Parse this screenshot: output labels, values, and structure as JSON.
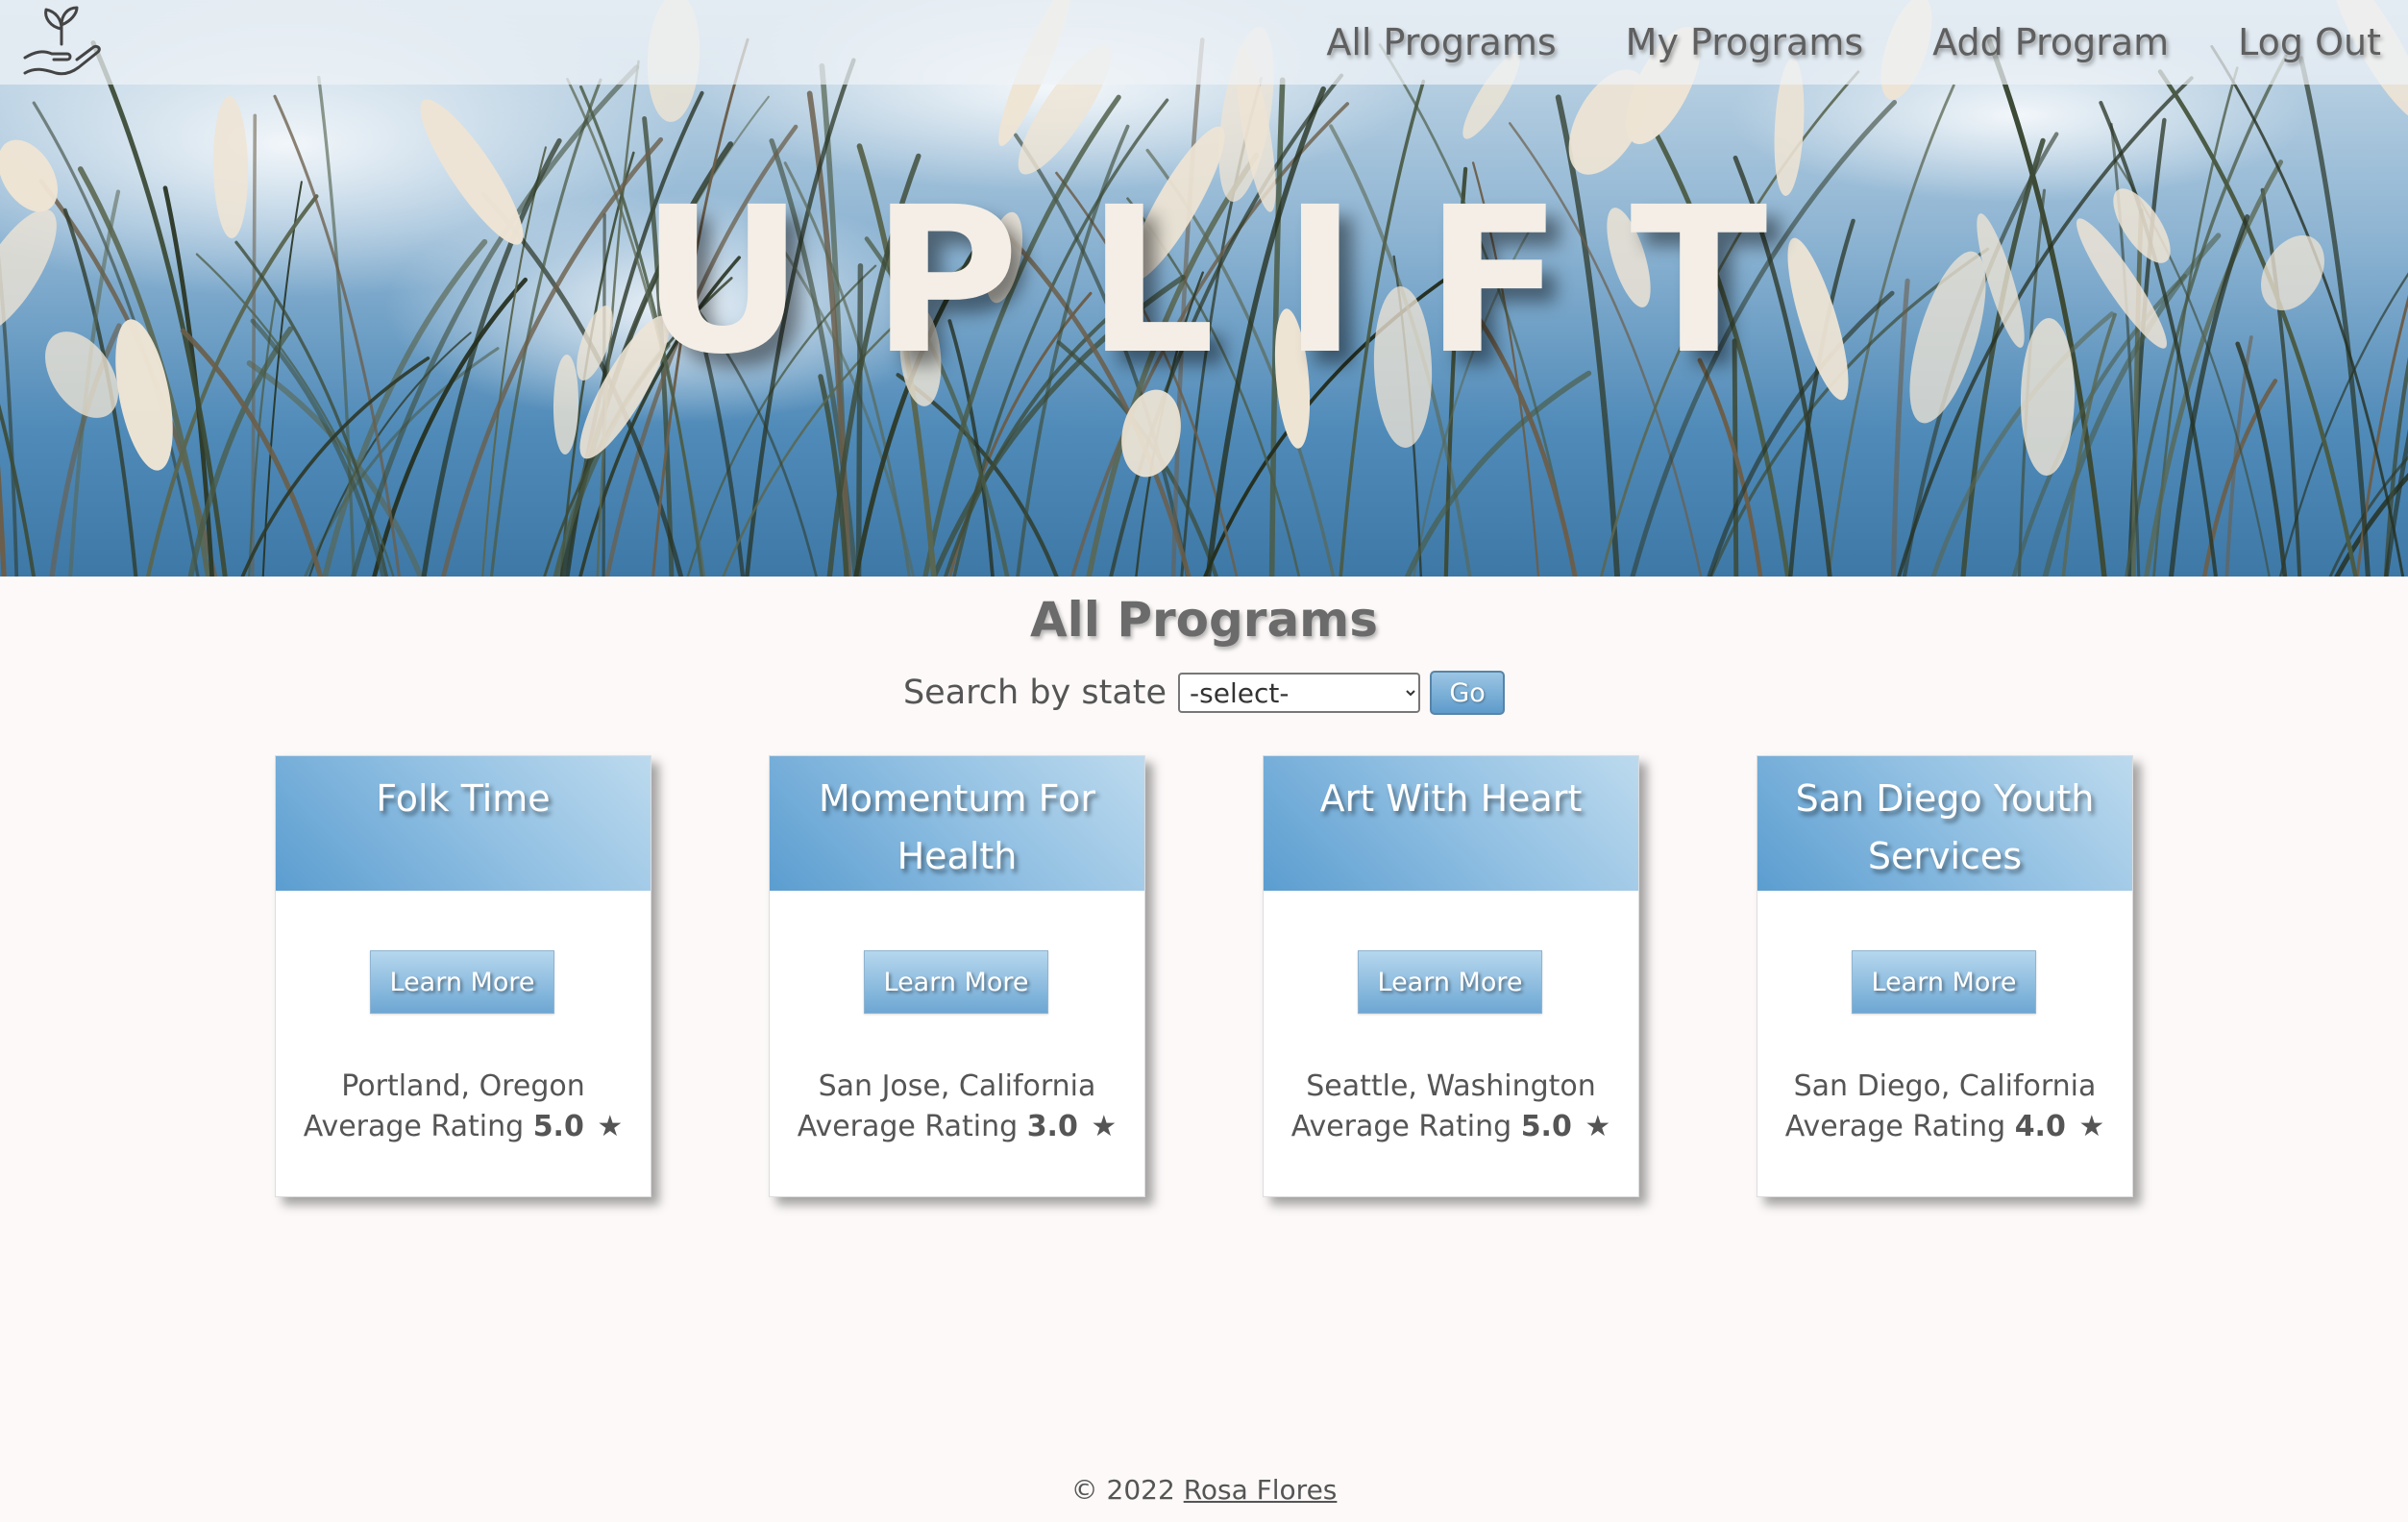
{
  "nav": {
    "logo_icon": "hand-with-sprout-icon",
    "links": [
      "All Programs",
      "My Programs",
      "Add Program",
      "Log Out"
    ]
  },
  "hero": {
    "brand": "UPLIFT"
  },
  "main": {
    "title": "All Programs",
    "search": {
      "label": "Search by state",
      "selected": "-select-",
      "button": "Go"
    },
    "programs": [
      {
        "name": "Folk Time",
        "button": "Learn More",
        "location": "Portland, Oregon",
        "rating_label": "Average Rating",
        "rating": "5.0"
      },
      {
        "name": "Momentum For Health",
        "button": "Learn More",
        "location": "San Jose, California",
        "rating_label": "Average Rating",
        "rating": "3.0"
      },
      {
        "name": "Art With Heart",
        "button": "Learn More",
        "location": "Seattle, Washington",
        "rating_label": "Average Rating",
        "rating": "5.0"
      },
      {
        "name": "San Diego Youth Services",
        "button": "Learn More",
        "location": "San Diego, California",
        "rating_label": "Average Rating",
        "rating": "4.0"
      }
    ],
    "star_icon": "star-icon"
  },
  "footer": {
    "copyright": "© 2022",
    "author": "Rosa Flores"
  },
  "colors": {
    "background": "#fcf9f8",
    "card_header": "#5b9dd0",
    "text": "#555555",
    "brand_text": "#f4eee6"
  }
}
